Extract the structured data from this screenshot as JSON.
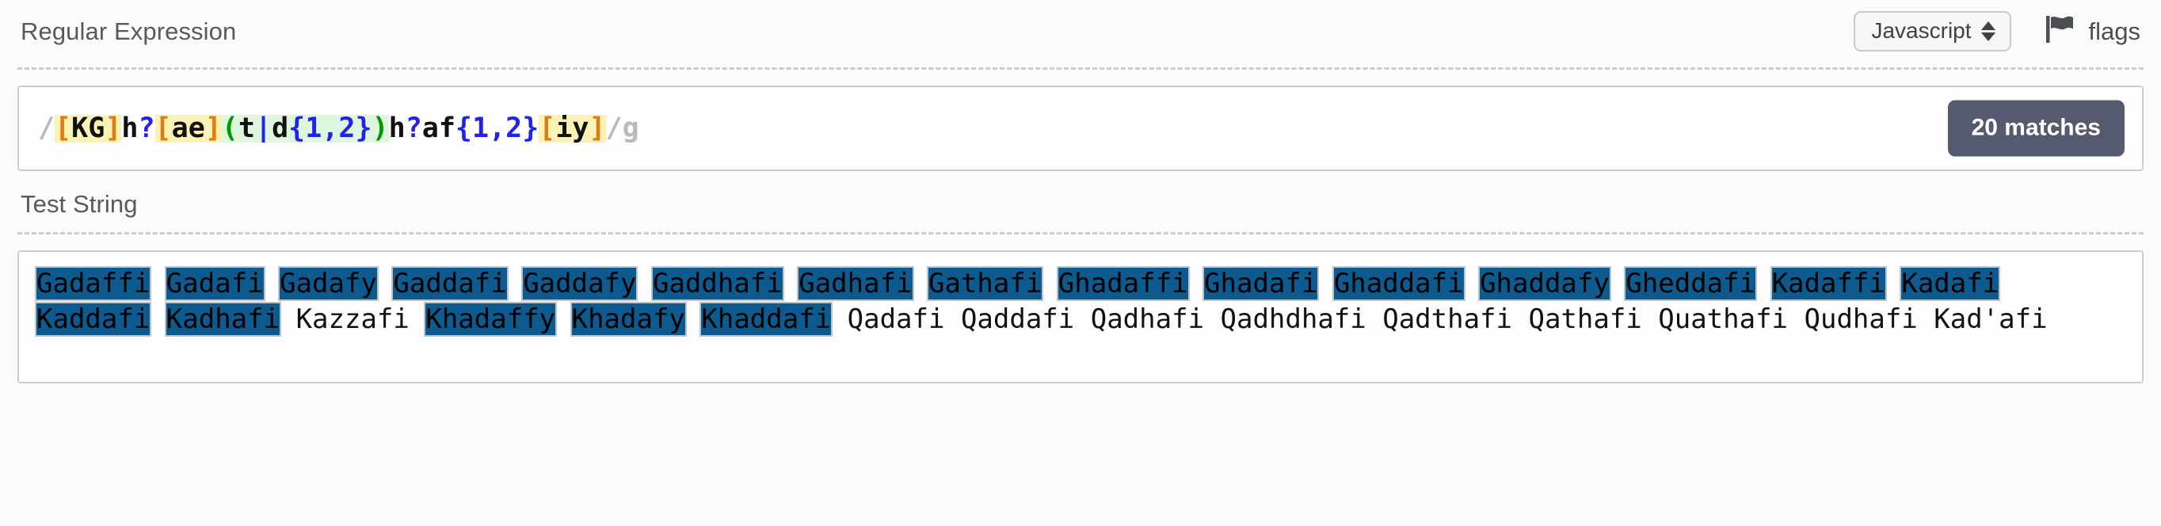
{
  "regex_section": {
    "title": "Regular Expression",
    "flavor": {
      "selected": "Javascript",
      "icon": "stepper-icon"
    },
    "flags": {
      "label": "flags",
      "icon": "flag-icon"
    },
    "pattern": {
      "open_delimiter": "/",
      "close_delimiter": "/",
      "flags": "g",
      "full": "/[KG]h?[ae](t|d{1,2})h?af{1,2}[iy]/g",
      "tokens": [
        {
          "text": "/",
          "kind": "delimiter"
        },
        {
          "text": "[",
          "kind": "class-bracket"
        },
        {
          "text": "KG",
          "kind": "class-body"
        },
        {
          "text": "]",
          "kind": "class-bracket"
        },
        {
          "text": "h",
          "kind": "literal"
        },
        {
          "text": "?",
          "kind": "quantifier"
        },
        {
          "text": "[",
          "kind": "class-bracket"
        },
        {
          "text": "ae",
          "kind": "class-body"
        },
        {
          "text": "]",
          "kind": "class-bracket"
        },
        {
          "text": "(",
          "kind": "group-paren"
        },
        {
          "text": "t",
          "kind": "literal"
        },
        {
          "text": "|",
          "kind": "alternation"
        },
        {
          "text": "d",
          "kind": "literal"
        },
        {
          "text": "{1,2}",
          "kind": "quantifier"
        },
        {
          "text": ")",
          "kind": "group-paren"
        },
        {
          "text": "h",
          "kind": "literal"
        },
        {
          "text": "?",
          "kind": "quantifier"
        },
        {
          "text": "af",
          "kind": "literal"
        },
        {
          "text": "{1,2}",
          "kind": "quantifier"
        },
        {
          "text": "[",
          "kind": "class-bracket"
        },
        {
          "text": "iy",
          "kind": "class-body"
        },
        {
          "text": "]",
          "kind": "class-bracket"
        },
        {
          "text": "/",
          "kind": "delimiter"
        },
        {
          "text": "g",
          "kind": "flags"
        }
      ]
    },
    "match_count_badge": "20 matches"
  },
  "test_section": {
    "title": "Test String",
    "segments": [
      {
        "text": "Gadaffi",
        "matched": true
      },
      {
        "text": " ",
        "matched": false
      },
      {
        "text": "Gadafi",
        "matched": true
      },
      {
        "text": " ",
        "matched": false
      },
      {
        "text": "Gadafy",
        "matched": true
      },
      {
        "text": " ",
        "matched": false
      },
      {
        "text": "Gaddafi",
        "matched": true
      },
      {
        "text": " ",
        "matched": false
      },
      {
        "text": "Gaddafy",
        "matched": true
      },
      {
        "text": " ",
        "matched": false
      },
      {
        "text": "Gaddhafi",
        "matched": true
      },
      {
        "text": " ",
        "matched": false
      },
      {
        "text": "Gadhafi",
        "matched": true
      },
      {
        "text": " ",
        "matched": false
      },
      {
        "text": "Gathafi",
        "matched": true
      },
      {
        "text": " ",
        "matched": false
      },
      {
        "text": "Ghadaffi",
        "matched": true
      },
      {
        "text": " ",
        "matched": false
      },
      {
        "text": "Ghadafi",
        "matched": true
      },
      {
        "text": " ",
        "matched": false
      },
      {
        "text": "Ghaddafi",
        "matched": true
      },
      {
        "text": " ",
        "matched": false
      },
      {
        "text": "Ghaddafy",
        "matched": true
      },
      {
        "text": " ",
        "matched": false
      },
      {
        "text": "Gheddafi",
        "matched": true
      },
      {
        "text": " ",
        "matched": false
      },
      {
        "text": "Kadaffi",
        "matched": true
      },
      {
        "text": " ",
        "matched": false
      },
      {
        "text": "Kadafi",
        "matched": true
      },
      {
        "text": " ",
        "matched": false
      },
      {
        "text": "Kaddafi",
        "matched": true
      },
      {
        "text": " ",
        "matched": false
      },
      {
        "text": "Kadhafi",
        "matched": true
      },
      {
        "text": " ",
        "matched": false
      },
      {
        "text": "Kazzafi",
        "matched": false
      },
      {
        "text": " ",
        "matched": false
      },
      {
        "text": "Khadaffy",
        "matched": true
      },
      {
        "text": " ",
        "matched": false
      },
      {
        "text": "Khadafy",
        "matched": true
      },
      {
        "text": " ",
        "matched": false
      },
      {
        "text": "Khaddafi",
        "matched": true
      },
      {
        "text": " ",
        "matched": false
      },
      {
        "text": "Qadafi",
        "matched": false
      },
      {
        "text": " ",
        "matched": false
      },
      {
        "text": "Qaddafi",
        "matched": false
      },
      {
        "text": " ",
        "matched": false
      },
      {
        "text": "Qadhafi",
        "matched": false
      },
      {
        "text": " ",
        "matched": false
      },
      {
        "text": "Qadhdhafi",
        "matched": false
      },
      {
        "text": " ",
        "matched": false
      },
      {
        "text": "Qadthafi",
        "matched": false
      },
      {
        "text": " ",
        "matched": false
      },
      {
        "text": "Qathafi",
        "matched": false
      },
      {
        "text": " ",
        "matched": false
      },
      {
        "text": "Quathafi",
        "matched": false
      },
      {
        "text": " ",
        "matched": false
      },
      {
        "text": "Qudhafi",
        "matched": false
      },
      {
        "text": " ",
        "matched": false
      },
      {
        "text": "Kad'afi",
        "matched": false
      }
    ]
  },
  "colors": {
    "match_highlight": "#0d5b8e",
    "badge_background": "#555a6e",
    "char_class_background": "#fbf3b6",
    "char_class_bracket": "#e07b10",
    "group_background": "#ddf6dd",
    "group_paren": "#009900",
    "quantifier": "#2222ee",
    "delimiter": "#b6b9bd",
    "heading_text": "#555a5e"
  }
}
